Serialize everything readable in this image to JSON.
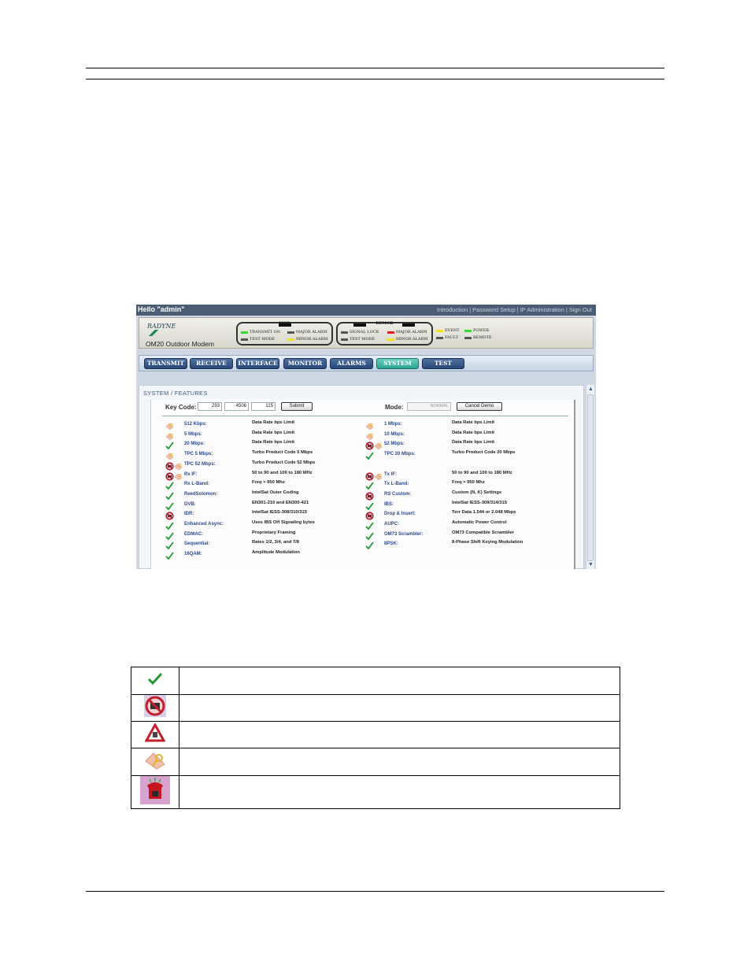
{
  "screen": {
    "hello": "Hello \"admin\"",
    "links": [
      "Introduction",
      "Password Setup",
      "IP Administration",
      "Sign Out"
    ],
    "logo_text": "RADYNE",
    "product": "OM20 Outdoor Modem",
    "mod": {
      "title": "MOD",
      "leds": [
        {
          "label": "TRANSMIT ON",
          "color": "#3ad63a"
        },
        {
          "label": "MAJOR ALARM",
          "color": "#555555"
        },
        {
          "label": "TEST MODE",
          "color": "#555555"
        },
        {
          "label": "MINOR ALARM",
          "color": "#f3e21b"
        }
      ]
    },
    "demod": {
      "title": "DEMOD",
      "leds": [
        {
          "label": "SIGNAL LOCK",
          "color": "#555555"
        },
        {
          "label": "MAJOR ALARM",
          "color": "#e0202a"
        },
        {
          "label": "TEST MODE",
          "color": "#555555"
        },
        {
          "label": "MINOR ALARM",
          "color": "#f3e21b"
        }
      ]
    },
    "status": [
      {
        "label": "EVENT",
        "color": "#f3e21b"
      },
      {
        "label": "POWER",
        "color": "#3ad63a"
      },
      {
        "label": "FAULT",
        "color": "#555555"
      },
      {
        "label": "REMOTE",
        "color": "#555555"
      }
    ],
    "tabs": [
      "TRANSMIT",
      "RECEIVE",
      "INTERFACE",
      "MONITOR",
      "ALARMS",
      "SYSTEM",
      "TEST"
    ],
    "active_tab": "SYSTEM",
    "breadcrumb": "SYSTEM / FEATURES",
    "key_code_label": "Key Code:",
    "key_code": [
      "293",
      "4506",
      "115"
    ],
    "submit": "Submit",
    "mode_label": "Mode:",
    "mode_value": "NORMAL",
    "cancel_demo": "Cancel Demo",
    "features_left": [
      {
        "icons": [
          "key"
        ],
        "label": "512 Kbps:",
        "desc": "Data Rate bps Limit"
      },
      {
        "icons": [
          "key"
        ],
        "label": "5 Mbps:",
        "desc": "Data Rate bps Limit"
      },
      {
        "icons": [
          "check"
        ],
        "label": "20 Mbps:",
        "desc": "Data Rate bps Limit"
      },
      {
        "icons": [
          "key"
        ],
        "label": "TPC 5 Mbps:",
        "desc": "Turbo Product Code 5 Mbps"
      },
      {
        "icons": [
          "no",
          "key"
        ],
        "label": "TPC 52 Mbps:",
        "desc": "Turbo Product Code 52 Mbps"
      },
      {
        "icons": [
          "no",
          "key"
        ],
        "label": "Rx IF:",
        "desc": "50 to 90 and 100 to 180 MHz"
      },
      {
        "icons": [
          "check"
        ],
        "label": "Rx L-Band:",
        "desc": "Freq > 950 Mhz"
      },
      {
        "icons": [
          "check"
        ],
        "label": "ReedSolomon:",
        "desc": "IntelSat Outer Coding"
      },
      {
        "icons": [
          "check"
        ],
        "label": "DVB:",
        "desc": "EN301-210 and EN300-421"
      },
      {
        "icons": [
          "no"
        ],
        "label": "IDR:",
        "desc": "IntelSat IESS-308/310/315"
      },
      {
        "icons": [
          "check"
        ],
        "label": "Enhanced Async:",
        "desc": "Uses IBS OH Signaling bytes"
      },
      {
        "icons": [
          "check"
        ],
        "label": "EDMAC:",
        "desc": "Proprietary Framing"
      },
      {
        "icons": [
          "check"
        ],
        "label": "Sequential:",
        "desc": "Rates 1/2, 3/4, and 7/8"
      },
      {
        "icons": [
          "check"
        ],
        "label": "16QAM:",
        "desc": "Amplitude Modulation"
      }
    ],
    "features_right": [
      {
        "icons": [
          "key"
        ],
        "label": "1 Mbps:",
        "desc": "Data Rate bps Limit"
      },
      {
        "icons": [
          "key"
        ],
        "label": "10 Mbps:",
        "desc": "Data Rate bps Limit"
      },
      {
        "icons": [
          "no",
          "key"
        ],
        "label": "52 Mbps:",
        "desc": "Data Rate bps Limit"
      },
      {
        "icons": [
          "check"
        ],
        "label": "TPC 20 Mbps:",
        "desc": "Turbo Product Code 20 Mbps"
      },
      {
        "icons": [],
        "label": "",
        "desc": ""
      },
      {
        "icons": [
          "no",
          "key"
        ],
        "label": "Tx IF:",
        "desc": "50 to 90 and 100 to 180 MHz"
      },
      {
        "icons": [
          "check"
        ],
        "label": "Tx L-Band:",
        "desc": "Freq > 950 Mhz"
      },
      {
        "icons": [
          "no"
        ],
        "label": "RS Custom:",
        "desc": "Custom (N, K) Settings"
      },
      {
        "icons": [
          "check"
        ],
        "label": "IBS:",
        "desc": "IntelSat IESS-309/314/315"
      },
      {
        "icons": [
          "no"
        ],
        "label": "Drop & Insert:",
        "desc": "Terr Data 1.544 or 2.048 Mbps"
      },
      {
        "icons": [
          "check"
        ],
        "label": "AUPC:",
        "desc": "Automatic Power Control"
      },
      {
        "icons": [
          "check"
        ],
        "label": "OM73 Scrambler:",
        "desc": "OM73 Compatible Scrambler"
      },
      {
        "icons": [
          "check"
        ],
        "label": "8PSK:",
        "desc": "8-Phase Shift Keying Modulation"
      }
    ]
  },
  "legend": [
    {
      "icon": "check-icon",
      "text": ""
    },
    {
      "icon": "no-hw-icon",
      "text": ""
    },
    {
      "icon": "warning-icon",
      "text": ""
    },
    {
      "icon": "key-icon",
      "text": ""
    },
    {
      "icon": "phone-icon",
      "text": ""
    }
  ]
}
